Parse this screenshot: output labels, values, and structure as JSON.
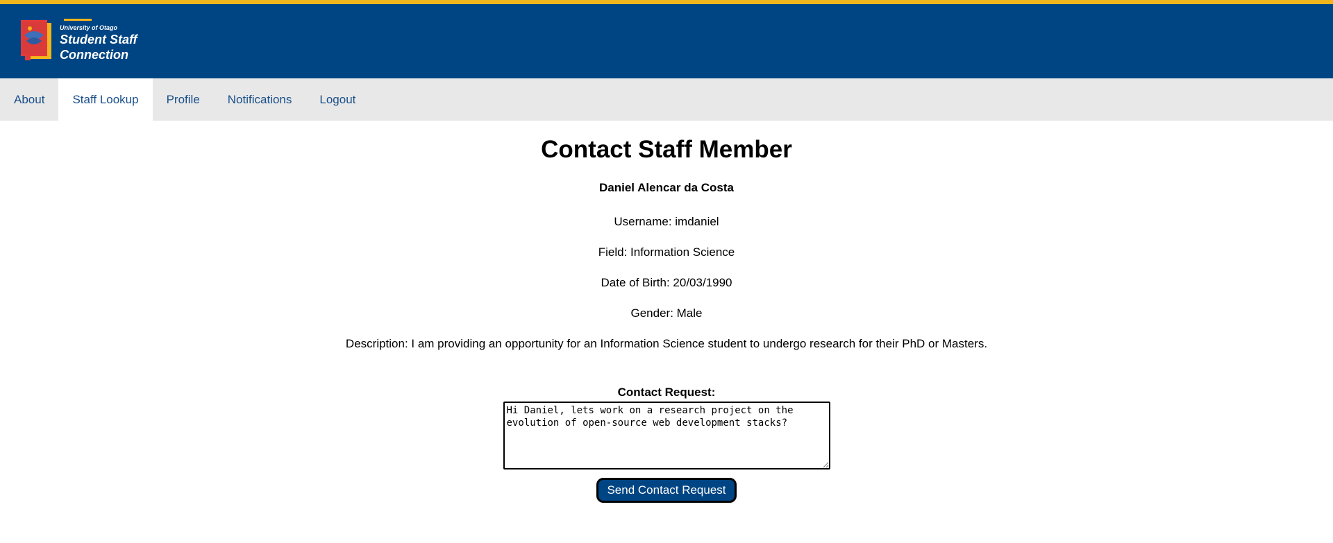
{
  "header": {
    "logo_university": "University of Otago",
    "logo_line1": "Student Staff",
    "logo_line2": "Connection"
  },
  "nav": {
    "items": [
      {
        "label": "About"
      },
      {
        "label": "Staff Lookup",
        "active": true
      },
      {
        "label": "Profile"
      },
      {
        "label": "Notifications"
      },
      {
        "label": "Logout"
      }
    ]
  },
  "main": {
    "title": "Contact Staff Member",
    "staff_name": "Daniel Alencar da Costa",
    "username": "Username: imdaniel",
    "field": "Field: Information Science",
    "dob": "Date of Birth: 20/03/1990",
    "gender": "Gender: Male",
    "description": "Description: I am providing an opportunity for an Information Science student to undergo research for their PhD or Masters.",
    "contact_label": "Contact Request:",
    "message_value": "Hi Daniel, lets work on a research project on the evolution of open-source web development stacks?",
    "send_label": "Send Contact Request"
  },
  "colors": {
    "accent_gold": "#f2b51b",
    "brand_blue": "#004583",
    "nav_bg": "#e8e8e8",
    "nav_text": "#1a4f8a"
  }
}
